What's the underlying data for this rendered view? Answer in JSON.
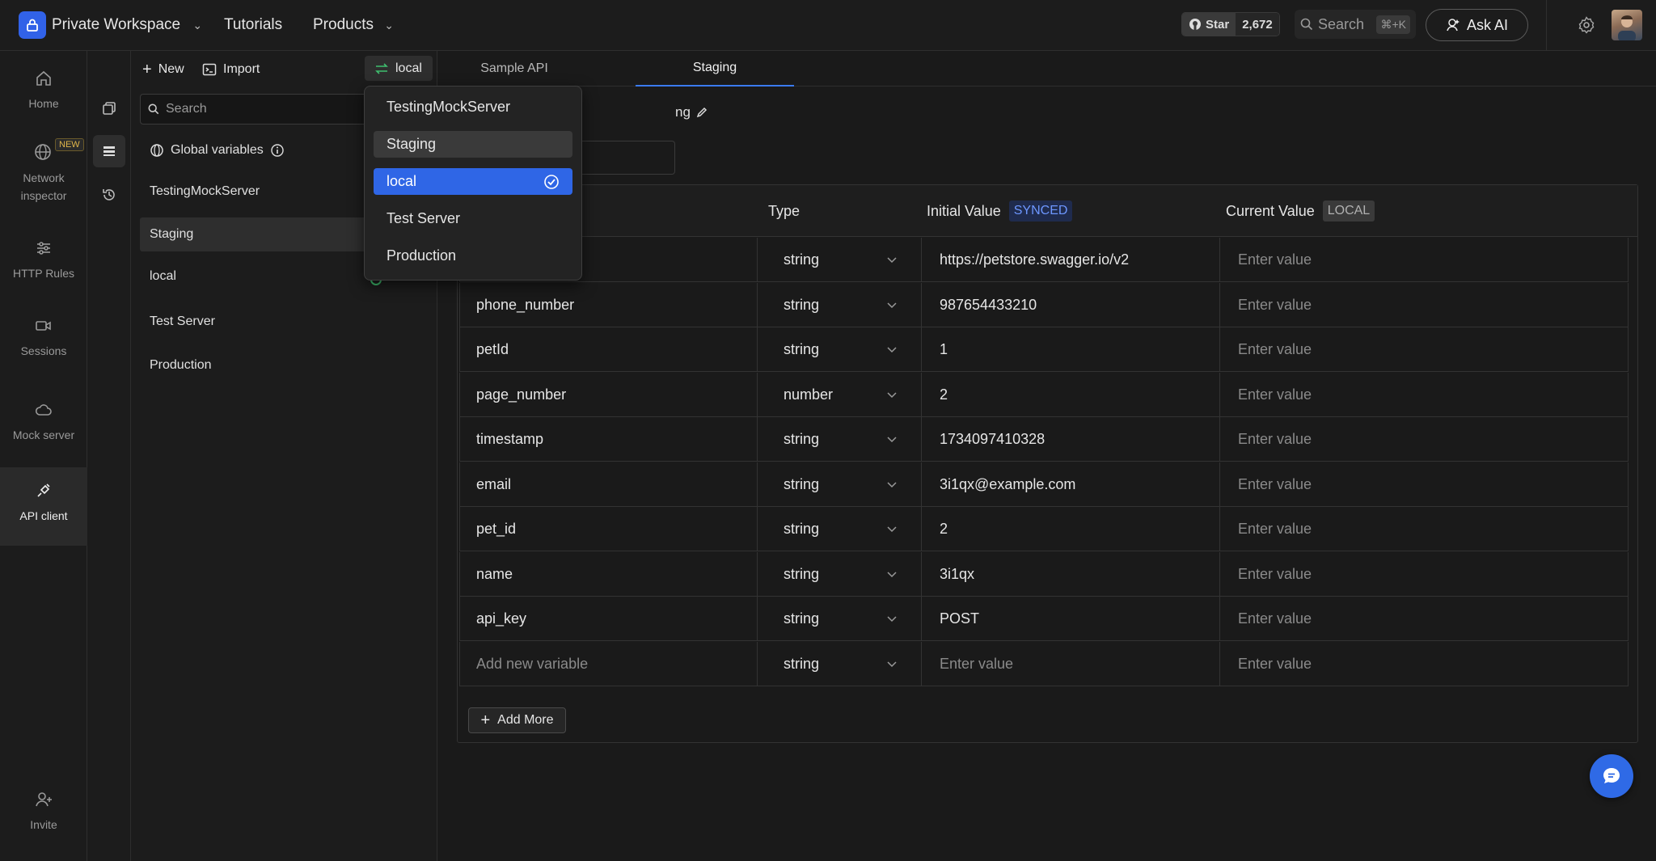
{
  "topbar": {
    "workspace": "Private Workspace",
    "tutorials": "Tutorials",
    "products": "Products",
    "github_star": "Star",
    "github_count": "2,672",
    "search_placeholder": "Search",
    "search_shortcut": "⌘+K",
    "ask_ai": "Ask AI"
  },
  "rail": {
    "home": "Home",
    "network_inspector_1": "Network",
    "network_inspector_2": "inspector",
    "new_badge": "NEW",
    "http_rules": "HTTP Rules",
    "sessions": "Sessions",
    "mock_server": "Mock server",
    "api_client": "API client",
    "invite": "Invite"
  },
  "panel": {
    "new": "New",
    "import": "Import",
    "env_chip": "local",
    "search_placeholder": "Search",
    "global_variables": "Global variables",
    "environments": [
      "TestingMockServer",
      "Staging",
      "local",
      "Test Server",
      "Production"
    ]
  },
  "main": {
    "tabs": [
      "Sample API",
      "Staging"
    ],
    "env_title_partial": "ng",
    "columns": {
      "type": "Type",
      "initial": "Initial Value",
      "synced": "SYNCED",
      "current": "Current Value",
      "local": "LOCAL"
    },
    "rows": [
      {
        "key": "",
        "type": "string",
        "initial": "https://petstore.swagger.io/v2",
        "current": "Enter value"
      },
      {
        "key": "phone_number",
        "type": "string",
        "initial": "987654433210",
        "current": "Enter value"
      },
      {
        "key": "petId",
        "type": "string",
        "initial": "1",
        "current": "Enter value"
      },
      {
        "key": "page_number",
        "type": "number",
        "initial": "2",
        "current": "Enter value"
      },
      {
        "key": "timestamp",
        "type": "string",
        "initial": "1734097410328",
        "current": "Enter value"
      },
      {
        "key": "email",
        "type": "string",
        "initial": "3i1qx@example.com",
        "current": "Enter value"
      },
      {
        "key": "pet_id",
        "type": "string",
        "initial": "2",
        "current": "Enter value"
      },
      {
        "key": "name",
        "type": "string",
        "initial": "3i1qx",
        "current": "Enter value"
      },
      {
        "key": "api_key",
        "type": "string",
        "initial": "POST",
        "current": "Enter value"
      }
    ],
    "new_row": {
      "key_placeholder": "Add new variable",
      "type": "string",
      "initial_placeholder": "Enter value",
      "current_placeholder": "Enter value"
    },
    "add_more": "Add More"
  },
  "dropdown": {
    "items": [
      "TestingMockServer",
      "Staging",
      "local",
      "Test Server",
      "Production"
    ],
    "selected": "local"
  },
  "colors": {
    "accent": "#2f66e6",
    "background": "#1a1a1a"
  }
}
